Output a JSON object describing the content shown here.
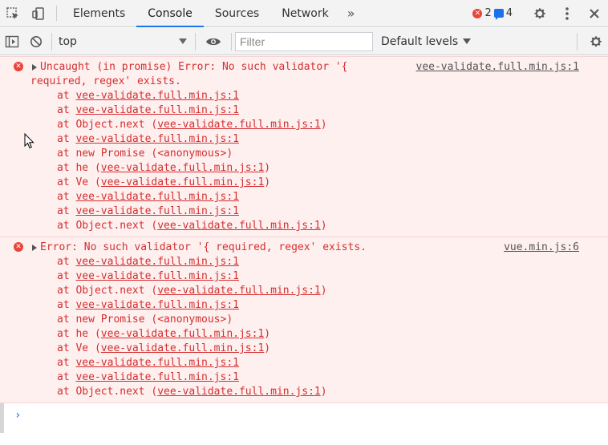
{
  "tabs": [
    {
      "label": "Elements",
      "active": false
    },
    {
      "label": "Console",
      "active": true
    },
    {
      "label": "Sources",
      "active": false
    },
    {
      "label": "Network",
      "active": false
    }
  ],
  "more_tabs": "»",
  "counters": {
    "errors": "2",
    "messages": "4"
  },
  "toolbar": {
    "context": "top",
    "filter_placeholder": "Filter",
    "levels": "Default levels"
  },
  "messages": [
    {
      "source": "vee-validate.full.min.js:1",
      "line1": "Uncaught (in promise) Error: No such validator '{",
      "line2": "required, regex' exists.",
      "stack": [
        {
          "at": "at ",
          "pre": "",
          "link": "vee-validate.full.min.js:1",
          "post": ""
        },
        {
          "at": "at ",
          "pre": "",
          "link": "vee-validate.full.min.js:1",
          "post": ""
        },
        {
          "at": "at ",
          "pre": "Object.next (",
          "link": "vee-validate.full.min.js:1",
          "post": ")"
        },
        {
          "at": "at ",
          "pre": "",
          "link": "vee-validate.full.min.js:1",
          "post": ""
        },
        {
          "at": "at ",
          "pre": "new Promise (<anonymous>)",
          "link": "",
          "post": ""
        },
        {
          "at": "at ",
          "pre": "he (",
          "link": "vee-validate.full.min.js:1",
          "post": ")"
        },
        {
          "at": "at ",
          "pre": "Ve (",
          "link": "vee-validate.full.min.js:1",
          "post": ")"
        },
        {
          "at": "at ",
          "pre": "",
          "link": "vee-validate.full.min.js:1",
          "post": ""
        },
        {
          "at": "at ",
          "pre": "",
          "link": "vee-validate.full.min.js:1",
          "post": ""
        },
        {
          "at": "at ",
          "pre": "Object.next (",
          "link": "vee-validate.full.min.js:1",
          "post": ")"
        }
      ]
    },
    {
      "source": "vue.min.js:6",
      "line1": "Error: No such validator '{ required, regex' exists.",
      "stack": [
        {
          "at": "at ",
          "pre": "",
          "link": "vee-validate.full.min.js:1",
          "post": ""
        },
        {
          "at": "at ",
          "pre": "",
          "link": "vee-validate.full.min.js:1",
          "post": ""
        },
        {
          "at": "at ",
          "pre": "Object.next (",
          "link": "vee-validate.full.min.js:1",
          "post": ")"
        },
        {
          "at": "at ",
          "pre": "",
          "link": "vee-validate.full.min.js:1",
          "post": ""
        },
        {
          "at": "at ",
          "pre": "new Promise (<anonymous>)",
          "link": "",
          "post": ""
        },
        {
          "at": "at ",
          "pre": "he (",
          "link": "vee-validate.full.min.js:1",
          "post": ")"
        },
        {
          "at": "at ",
          "pre": "Ve (",
          "link": "vee-validate.full.min.js:1",
          "post": ")"
        },
        {
          "at": "at ",
          "pre": "",
          "link": "vee-validate.full.min.js:1",
          "post": ""
        },
        {
          "at": "at ",
          "pre": "",
          "link": "vee-validate.full.min.js:1",
          "post": ""
        },
        {
          "at": "at ",
          "pre": "Object.next (",
          "link": "vee-validate.full.min.js:1",
          "post": ")"
        }
      ]
    }
  ],
  "prompt_symbol": "›",
  "colors": {
    "accent": "#1a73e8",
    "error": "#d32f2f",
    "error_bg": "#fff0f0"
  }
}
